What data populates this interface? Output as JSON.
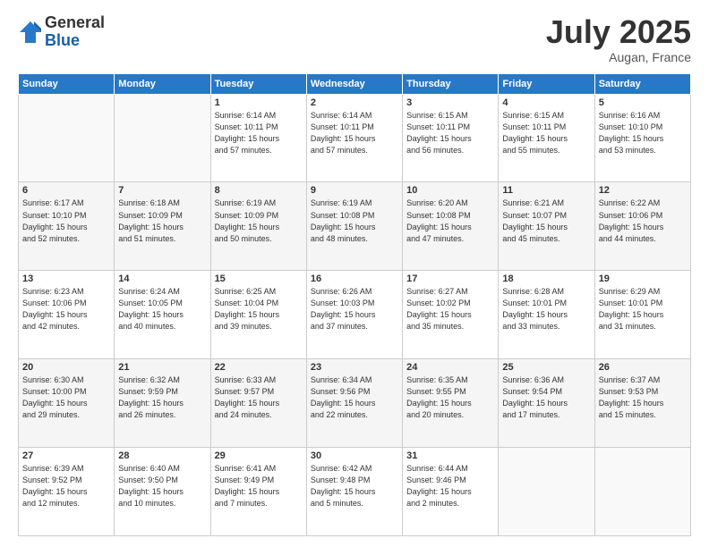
{
  "logo": {
    "general": "General",
    "blue": "Blue"
  },
  "title": "July 2025",
  "location": "Augan, France",
  "days_header": [
    "Sunday",
    "Monday",
    "Tuesday",
    "Wednesday",
    "Thursday",
    "Friday",
    "Saturday"
  ],
  "weeks": [
    [
      {
        "day": "",
        "info": ""
      },
      {
        "day": "",
        "info": ""
      },
      {
        "day": "1",
        "info": "Sunrise: 6:14 AM\nSunset: 10:11 PM\nDaylight: 15 hours\nand 57 minutes."
      },
      {
        "day": "2",
        "info": "Sunrise: 6:14 AM\nSunset: 10:11 PM\nDaylight: 15 hours\nand 57 minutes."
      },
      {
        "day": "3",
        "info": "Sunrise: 6:15 AM\nSunset: 10:11 PM\nDaylight: 15 hours\nand 56 minutes."
      },
      {
        "day": "4",
        "info": "Sunrise: 6:15 AM\nSunset: 10:11 PM\nDaylight: 15 hours\nand 55 minutes."
      },
      {
        "day": "5",
        "info": "Sunrise: 6:16 AM\nSunset: 10:10 PM\nDaylight: 15 hours\nand 53 minutes."
      }
    ],
    [
      {
        "day": "6",
        "info": "Sunrise: 6:17 AM\nSunset: 10:10 PM\nDaylight: 15 hours\nand 52 minutes."
      },
      {
        "day": "7",
        "info": "Sunrise: 6:18 AM\nSunset: 10:09 PM\nDaylight: 15 hours\nand 51 minutes."
      },
      {
        "day": "8",
        "info": "Sunrise: 6:19 AM\nSunset: 10:09 PM\nDaylight: 15 hours\nand 50 minutes."
      },
      {
        "day": "9",
        "info": "Sunrise: 6:19 AM\nSunset: 10:08 PM\nDaylight: 15 hours\nand 48 minutes."
      },
      {
        "day": "10",
        "info": "Sunrise: 6:20 AM\nSunset: 10:08 PM\nDaylight: 15 hours\nand 47 minutes."
      },
      {
        "day": "11",
        "info": "Sunrise: 6:21 AM\nSunset: 10:07 PM\nDaylight: 15 hours\nand 45 minutes."
      },
      {
        "day": "12",
        "info": "Sunrise: 6:22 AM\nSunset: 10:06 PM\nDaylight: 15 hours\nand 44 minutes."
      }
    ],
    [
      {
        "day": "13",
        "info": "Sunrise: 6:23 AM\nSunset: 10:06 PM\nDaylight: 15 hours\nand 42 minutes."
      },
      {
        "day": "14",
        "info": "Sunrise: 6:24 AM\nSunset: 10:05 PM\nDaylight: 15 hours\nand 40 minutes."
      },
      {
        "day": "15",
        "info": "Sunrise: 6:25 AM\nSunset: 10:04 PM\nDaylight: 15 hours\nand 39 minutes."
      },
      {
        "day": "16",
        "info": "Sunrise: 6:26 AM\nSunset: 10:03 PM\nDaylight: 15 hours\nand 37 minutes."
      },
      {
        "day": "17",
        "info": "Sunrise: 6:27 AM\nSunset: 10:02 PM\nDaylight: 15 hours\nand 35 minutes."
      },
      {
        "day": "18",
        "info": "Sunrise: 6:28 AM\nSunset: 10:01 PM\nDaylight: 15 hours\nand 33 minutes."
      },
      {
        "day": "19",
        "info": "Sunrise: 6:29 AM\nSunset: 10:01 PM\nDaylight: 15 hours\nand 31 minutes."
      }
    ],
    [
      {
        "day": "20",
        "info": "Sunrise: 6:30 AM\nSunset: 10:00 PM\nDaylight: 15 hours\nand 29 minutes."
      },
      {
        "day": "21",
        "info": "Sunrise: 6:32 AM\nSunset: 9:59 PM\nDaylight: 15 hours\nand 26 minutes."
      },
      {
        "day": "22",
        "info": "Sunrise: 6:33 AM\nSunset: 9:57 PM\nDaylight: 15 hours\nand 24 minutes."
      },
      {
        "day": "23",
        "info": "Sunrise: 6:34 AM\nSunset: 9:56 PM\nDaylight: 15 hours\nand 22 minutes."
      },
      {
        "day": "24",
        "info": "Sunrise: 6:35 AM\nSunset: 9:55 PM\nDaylight: 15 hours\nand 20 minutes."
      },
      {
        "day": "25",
        "info": "Sunrise: 6:36 AM\nSunset: 9:54 PM\nDaylight: 15 hours\nand 17 minutes."
      },
      {
        "day": "26",
        "info": "Sunrise: 6:37 AM\nSunset: 9:53 PM\nDaylight: 15 hours\nand 15 minutes."
      }
    ],
    [
      {
        "day": "27",
        "info": "Sunrise: 6:39 AM\nSunset: 9:52 PM\nDaylight: 15 hours\nand 12 minutes."
      },
      {
        "day": "28",
        "info": "Sunrise: 6:40 AM\nSunset: 9:50 PM\nDaylight: 15 hours\nand 10 minutes."
      },
      {
        "day": "29",
        "info": "Sunrise: 6:41 AM\nSunset: 9:49 PM\nDaylight: 15 hours\nand 7 minutes."
      },
      {
        "day": "30",
        "info": "Sunrise: 6:42 AM\nSunset: 9:48 PM\nDaylight: 15 hours\nand 5 minutes."
      },
      {
        "day": "31",
        "info": "Sunrise: 6:44 AM\nSunset: 9:46 PM\nDaylight: 15 hours\nand 2 minutes."
      },
      {
        "day": "",
        "info": ""
      },
      {
        "day": "",
        "info": ""
      }
    ]
  ]
}
